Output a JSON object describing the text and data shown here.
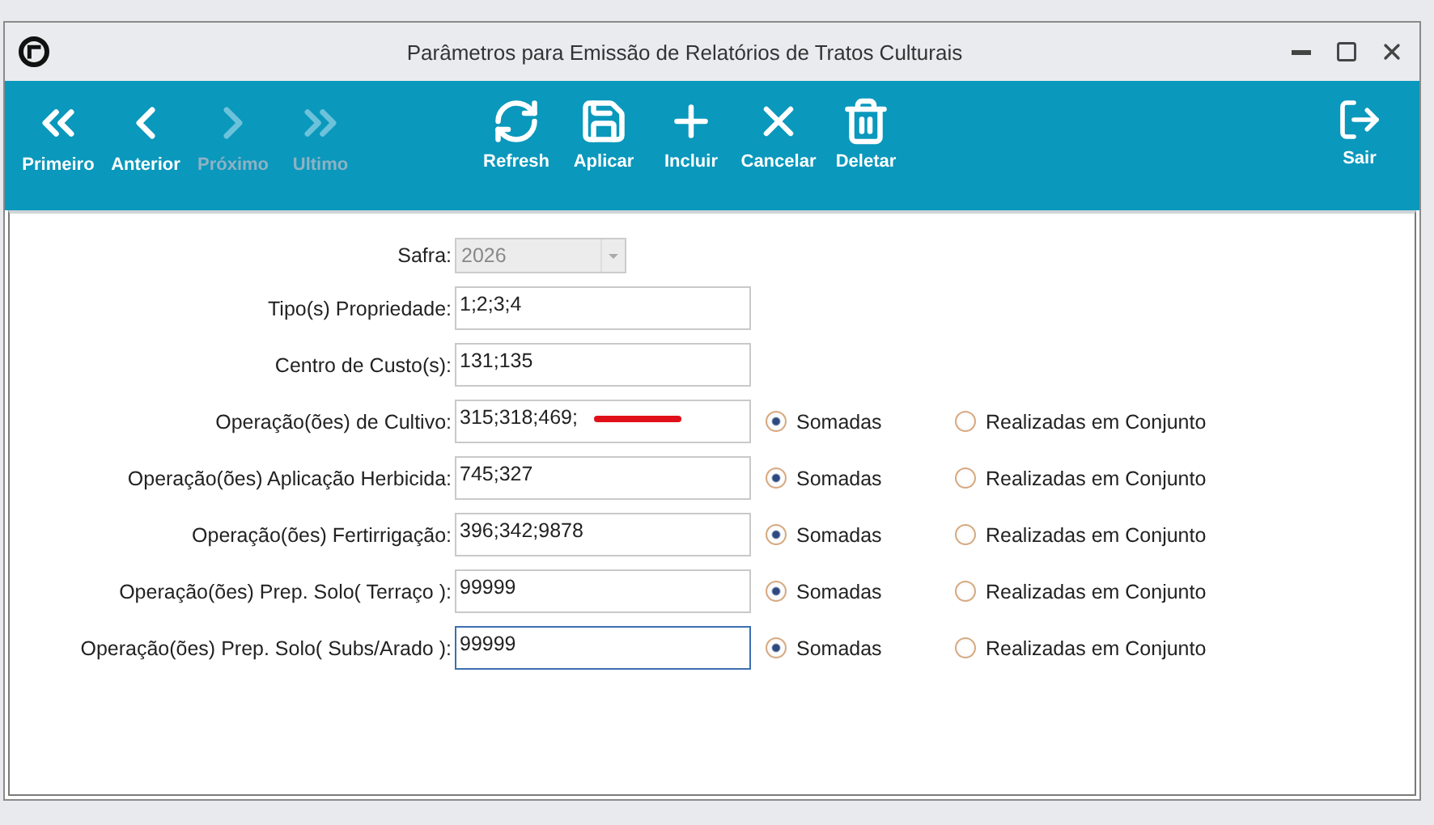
{
  "window": {
    "title": "Parâmetros para Emissão de Relatórios de Tratos Culturais"
  },
  "toolbar": {
    "nav": [
      {
        "label": "Primeiro",
        "disabled": false
      },
      {
        "label": "Anterior",
        "disabled": false
      },
      {
        "label": "Próximo",
        "disabled": true
      },
      {
        "label": "Ultimo",
        "disabled": true
      }
    ],
    "actions": [
      {
        "label": "Refresh"
      },
      {
        "label": "Aplicar"
      },
      {
        "label": "Incluir"
      },
      {
        "label": "Cancelar"
      },
      {
        "label": "Deletar"
      }
    ],
    "exit": {
      "label": "Sair"
    }
  },
  "form": {
    "rows": [
      {
        "kind": "combo",
        "label": "Safra:",
        "value": "2026",
        "disabled": true
      },
      {
        "kind": "text",
        "label": "Tipo(s) Propriedade:",
        "value": "1;2;3;4",
        "focused": false,
        "marked": false
      },
      {
        "kind": "text",
        "label": "Centro de Custo(s):",
        "value": "131;135",
        "focused": false,
        "marked": false
      },
      {
        "kind": "text",
        "label": "Operação(ões) de Cultivo:",
        "value": "315;318;469;",
        "focused": false,
        "marked": true,
        "options": [
          {
            "label": "Somadas",
            "selected": true
          },
          {
            "label": "Realizadas em Conjunto",
            "selected": false
          }
        ]
      },
      {
        "kind": "text",
        "label": "Operação(ões) Aplicação Herbicida:",
        "value": "745;327",
        "focused": false,
        "marked": false,
        "options": [
          {
            "label": "Somadas",
            "selected": true
          },
          {
            "label": "Realizadas em Conjunto",
            "selected": false
          }
        ]
      },
      {
        "kind": "text",
        "label": "Operação(ões) Fertirrigação:",
        "value": "396;342;9878",
        "focused": false,
        "marked": false,
        "options": [
          {
            "label": "Somadas",
            "selected": true
          },
          {
            "label": "Realizadas em Conjunto",
            "selected": false
          }
        ]
      },
      {
        "kind": "text",
        "label": "Operação(ões) Prep. Solo( Terraço ):",
        "value": "99999",
        "focused": false,
        "marked": false,
        "options": [
          {
            "label": "Somadas",
            "selected": true
          },
          {
            "label": "Realizadas em Conjunto",
            "selected": false
          }
        ]
      },
      {
        "kind": "text",
        "label": "Operação(ões) Prep. Solo( Subs/Arado ):",
        "value": "99999",
        "focused": true,
        "marked": false,
        "options": [
          {
            "label": "Somadas",
            "selected": true
          },
          {
            "label": "Realizadas em Conjunto",
            "selected": false
          }
        ]
      }
    ]
  }
}
